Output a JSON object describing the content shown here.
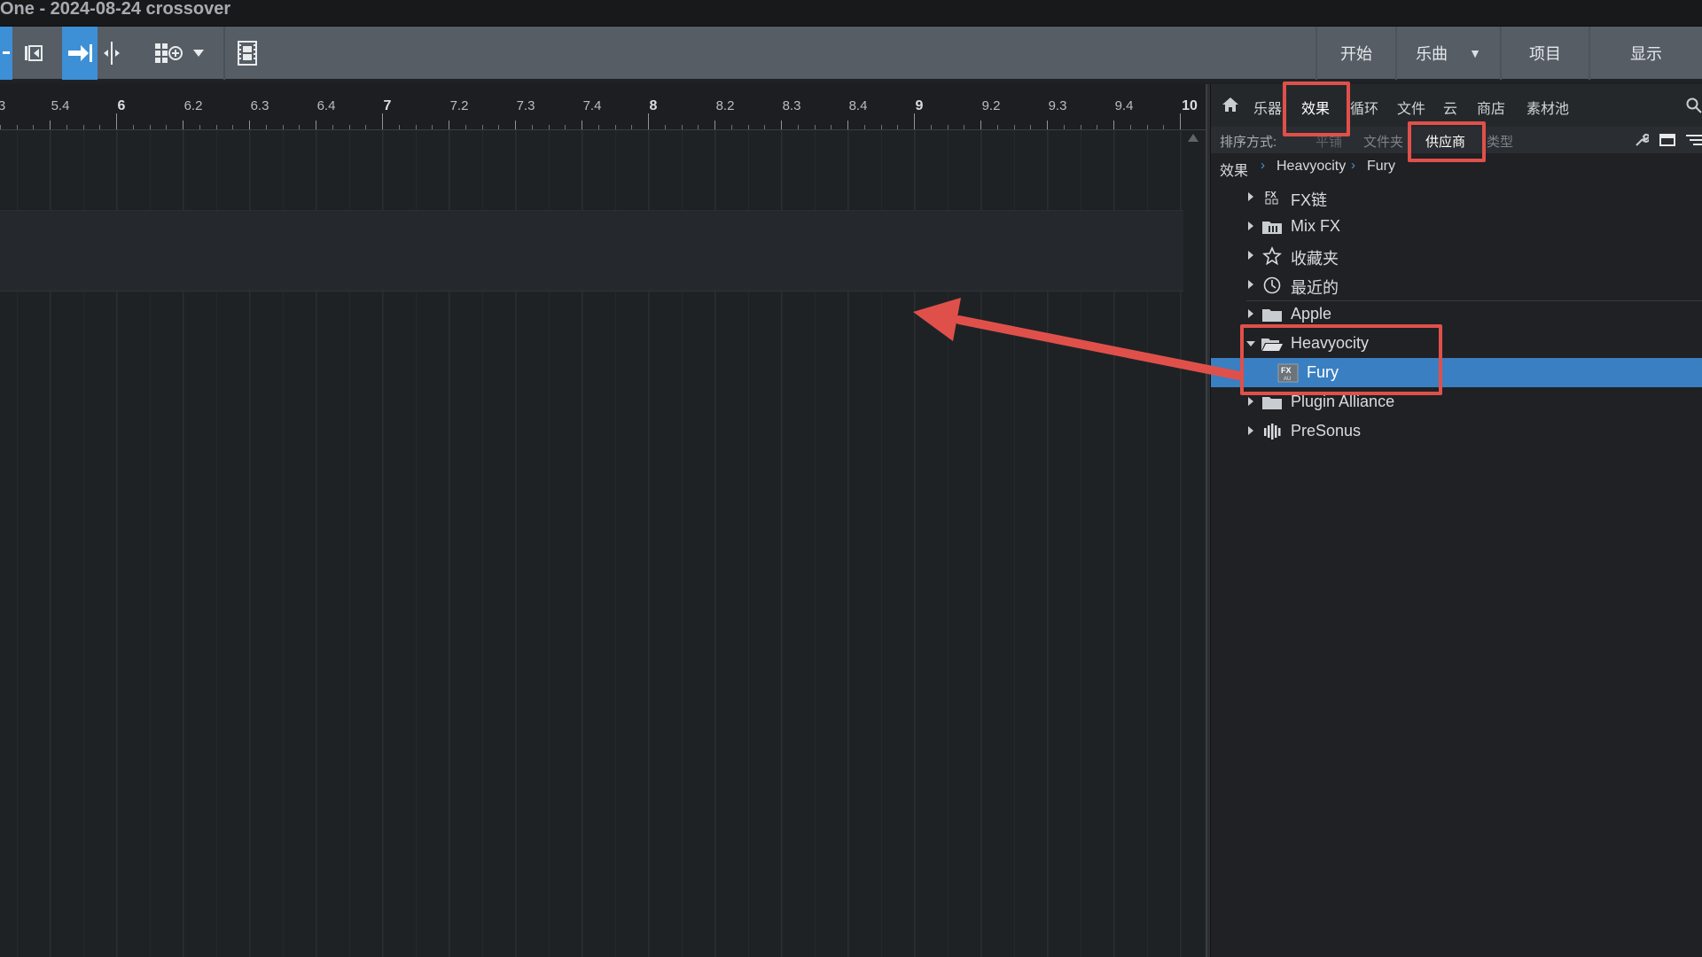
{
  "window": {
    "title": "One - 2024-08-24 crossover"
  },
  "toolbar": {
    "nav_tabs": [
      {
        "label": "开始"
      },
      {
        "label": "乐曲"
      },
      {
        "label": "项目"
      },
      {
        "label": "显示"
      }
    ],
    "icons": [
      "minus-icon",
      "loop-marker-icon",
      "snap-arrow-icon",
      "split-icon",
      "grid-add-icon",
      "dropdown-caret-icon",
      "film-icon"
    ]
  },
  "ruler": {
    "labels": [
      "3",
      "5.4",
      "6",
      "6.2",
      "6.3",
      "6.4",
      "7",
      "7.2",
      "7.3",
      "7.4",
      "8",
      "8.2",
      "8.3",
      "8.4",
      "9",
      "9.2",
      "9.3",
      "9.4",
      "10"
    ]
  },
  "browser": {
    "tabs": [
      {
        "label": "乐器"
      },
      {
        "label": "效果"
      },
      {
        "label": "循环"
      },
      {
        "label": "文件"
      },
      {
        "label": "云"
      },
      {
        "label": "商店"
      },
      {
        "label": "素材池"
      }
    ],
    "active_tab": "效果",
    "sort": {
      "label": "排序方式:",
      "options": [
        "平铺",
        "文件夹",
        "供应商",
        "类型"
      ],
      "active": "供应商"
    },
    "breadcrumb": [
      "效果",
      "Heavyocity",
      "Fury"
    ],
    "tree": [
      {
        "label": "FX链",
        "icon": "fx-chain-icon",
        "expanded": false
      },
      {
        "label": "Mix FX",
        "icon": "mix-fx-icon",
        "expanded": false
      },
      {
        "label": "收藏夹",
        "icon": "star-icon",
        "expanded": false
      },
      {
        "label": "最近的",
        "icon": "clock-icon",
        "expanded": false
      },
      {
        "label": "Apple",
        "icon": "folder-icon",
        "expanded": false
      },
      {
        "label": "Heavyocity",
        "icon": "folder-open-icon",
        "expanded": true
      },
      {
        "label": "Fury",
        "icon": "fx-au-icon",
        "selected": true
      },
      {
        "label": "Plugin Alliance",
        "icon": "folder-icon",
        "expanded": false
      },
      {
        "label": "PreSonus",
        "icon": "presonus-icon",
        "expanded": false
      }
    ]
  },
  "colors": {
    "accent_blue": "#3d8fd6",
    "selection": "#3a7fc1",
    "annotation_red": "#e0504a"
  }
}
